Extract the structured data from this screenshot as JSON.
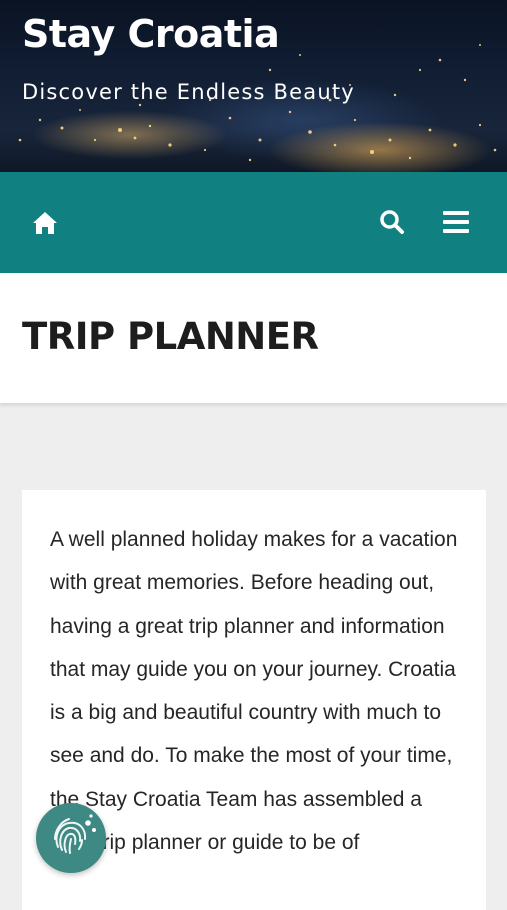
{
  "header": {
    "site_title": "Stay Croatia",
    "tagline": "Discover the Endless Beauty"
  },
  "navbar": {
    "background": "#108080",
    "icons": [
      "home-icon",
      "search-icon",
      "menu-icon"
    ]
  },
  "page": {
    "title": "TRIP PLANNER"
  },
  "content": {
    "paragraph": "A well planned holiday makes for a vacation with great memories. Before heading out, having a great trip planner and information that may guide you on your journey. Croatia is a big and beautiful country with much to see and do. To make the most of your time, the Stay Croatia Team has assembled a brief trip planner or guide to be of"
  },
  "accessibility_button": {
    "icon": "fingerprint-icon",
    "color": "#3e8984"
  }
}
